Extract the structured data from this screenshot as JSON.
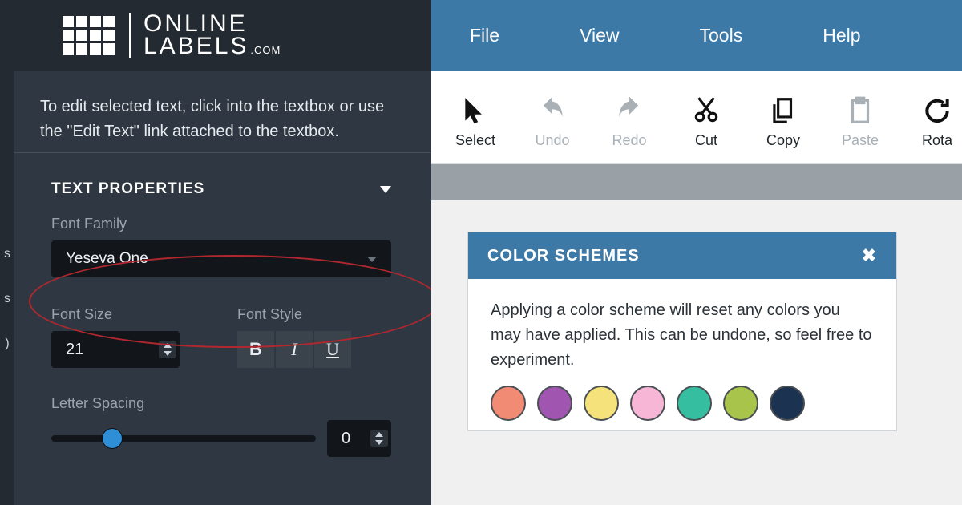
{
  "logo": {
    "line1": "ONLINE",
    "line2": "LABELS",
    "suffix": ".COM"
  },
  "sidebar_tabs": [
    "s",
    "s",
    ")"
  ],
  "help_text": "To edit selected text, click into the textbox or use the \"Edit Text\" link attached to the textbox.",
  "text_properties": {
    "header": "TEXT PROPERTIES",
    "font_family_label": "Font Family",
    "font_family_value": "Yeseva One",
    "font_size_label": "Font Size",
    "font_size_value": "21",
    "font_style_label": "Font Style",
    "bold": "B",
    "italic": "I",
    "underline": "U",
    "letter_spacing_label": "Letter Spacing",
    "letter_spacing_value": "0"
  },
  "menubar": [
    "File",
    "View",
    "Tools",
    "Help"
  ],
  "toolbar": [
    {
      "label": "Select",
      "icon": "cursor",
      "disabled": false
    },
    {
      "label": "Undo",
      "icon": "undo",
      "disabled": true
    },
    {
      "label": "Redo",
      "icon": "redo",
      "disabled": true
    },
    {
      "label": "Cut",
      "icon": "cut",
      "disabled": false
    },
    {
      "label": "Copy",
      "icon": "copy",
      "disabled": false
    },
    {
      "label": "Paste",
      "icon": "paste",
      "disabled": true
    },
    {
      "label": "Rota",
      "icon": "rotate",
      "disabled": false
    }
  ],
  "dialog": {
    "title": "COLOR SCHEMES",
    "body": "Applying a color scheme will reset any colors you may have applied. This can be undone, so feel free to experiment.",
    "swatches": [
      "#f18b74",
      "#a056b0",
      "#f5e27a",
      "#f7b6d5",
      "#35bfa0",
      "#a8c44a",
      "#1c3251"
    ]
  }
}
